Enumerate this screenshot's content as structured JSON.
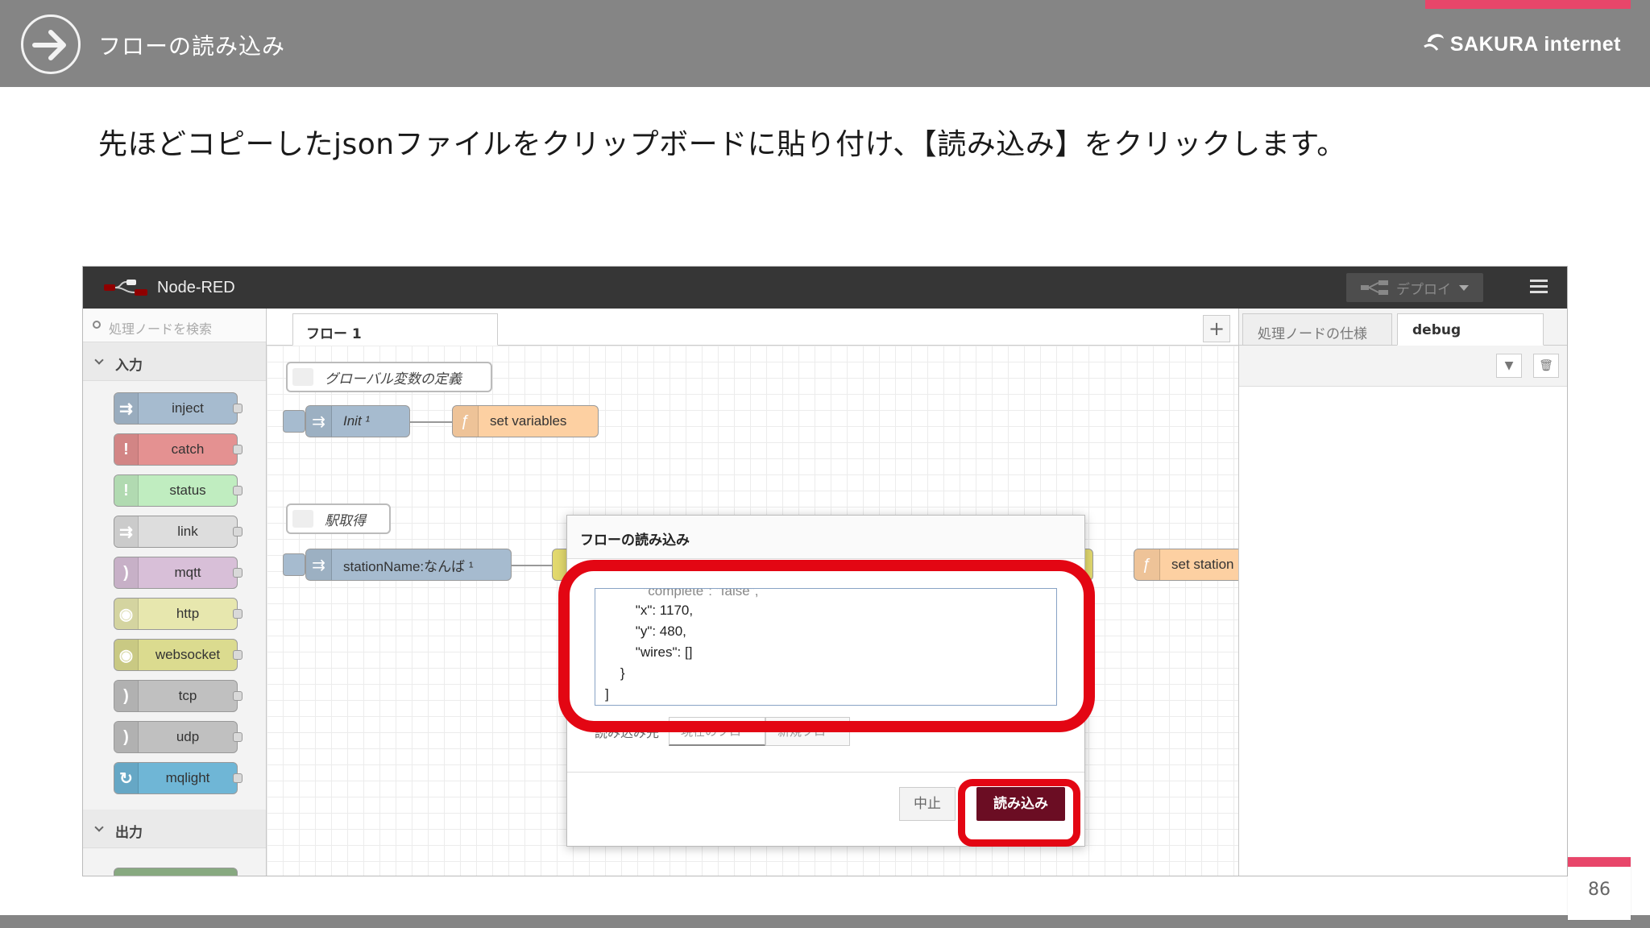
{
  "slide": {
    "title": "フローの読み込み",
    "brand": "SAKURA internet",
    "instruction": "先ほどコピーしたjsonファイルをクリップボードに貼り付け、【読み込み】をクリックします。",
    "page_number": "86"
  },
  "nodered": {
    "app_name": "Node-RED",
    "deploy_label": "デプロイ",
    "palette": {
      "search_placeholder": "処理ノードを検索",
      "categories": [
        {
          "label": "入力"
        },
        {
          "label": "出力"
        }
      ],
      "nodes": [
        {
          "label": "inject",
          "color": "#a6bbcf"
        },
        {
          "label": "catch",
          "color": "#e49191"
        },
        {
          "label": "status",
          "color": "#c0edc0"
        },
        {
          "label": "link",
          "color": "#dddddd"
        },
        {
          "label": "mqtt",
          "color": "#d8bfd8"
        },
        {
          "label": "http",
          "color": "#e7e7ae"
        },
        {
          "label": "websocket",
          "color": "#dbdb8f"
        },
        {
          "label": "tcp",
          "color": "#c0c0c0"
        },
        {
          "label": "udp",
          "color": "#c0c0c0"
        },
        {
          "label": "mqlight",
          "color": "#6fb6d6"
        }
      ]
    },
    "workspace": {
      "tab_label": "フロー 1",
      "comments": [
        {
          "label": "グローバル変数の定義"
        },
        {
          "label": "駅取得"
        }
      ],
      "flow_nodes": [
        {
          "label": "Init ¹"
        },
        {
          "label": "set variables"
        },
        {
          "label": "stationName:なんば ¹"
        },
        {
          "label": "set station"
        }
      ]
    },
    "sidebar": {
      "tabs": [
        {
          "label": "処理ノードの仕様"
        },
        {
          "label": "debug"
        }
      ]
    },
    "dialog": {
      "title": "フローの読み込み",
      "json_lines": [
        "        \"x\": 1170,",
        "        \"y\": 480,",
        "        \"wires\": []",
        "    }",
        "]"
      ],
      "import_to_label": "読み込み先",
      "import_to_options": [
        {
          "label": "現在のフロー"
        },
        {
          "label": "新規フロー"
        }
      ],
      "cancel_label": "中止",
      "import_label": "読み込み"
    }
  },
  "colors": {
    "header_bg": "#858585",
    "accent_pink": "#e8466a",
    "highlight_red": "#e30613",
    "import_button": "#6b0d23"
  }
}
